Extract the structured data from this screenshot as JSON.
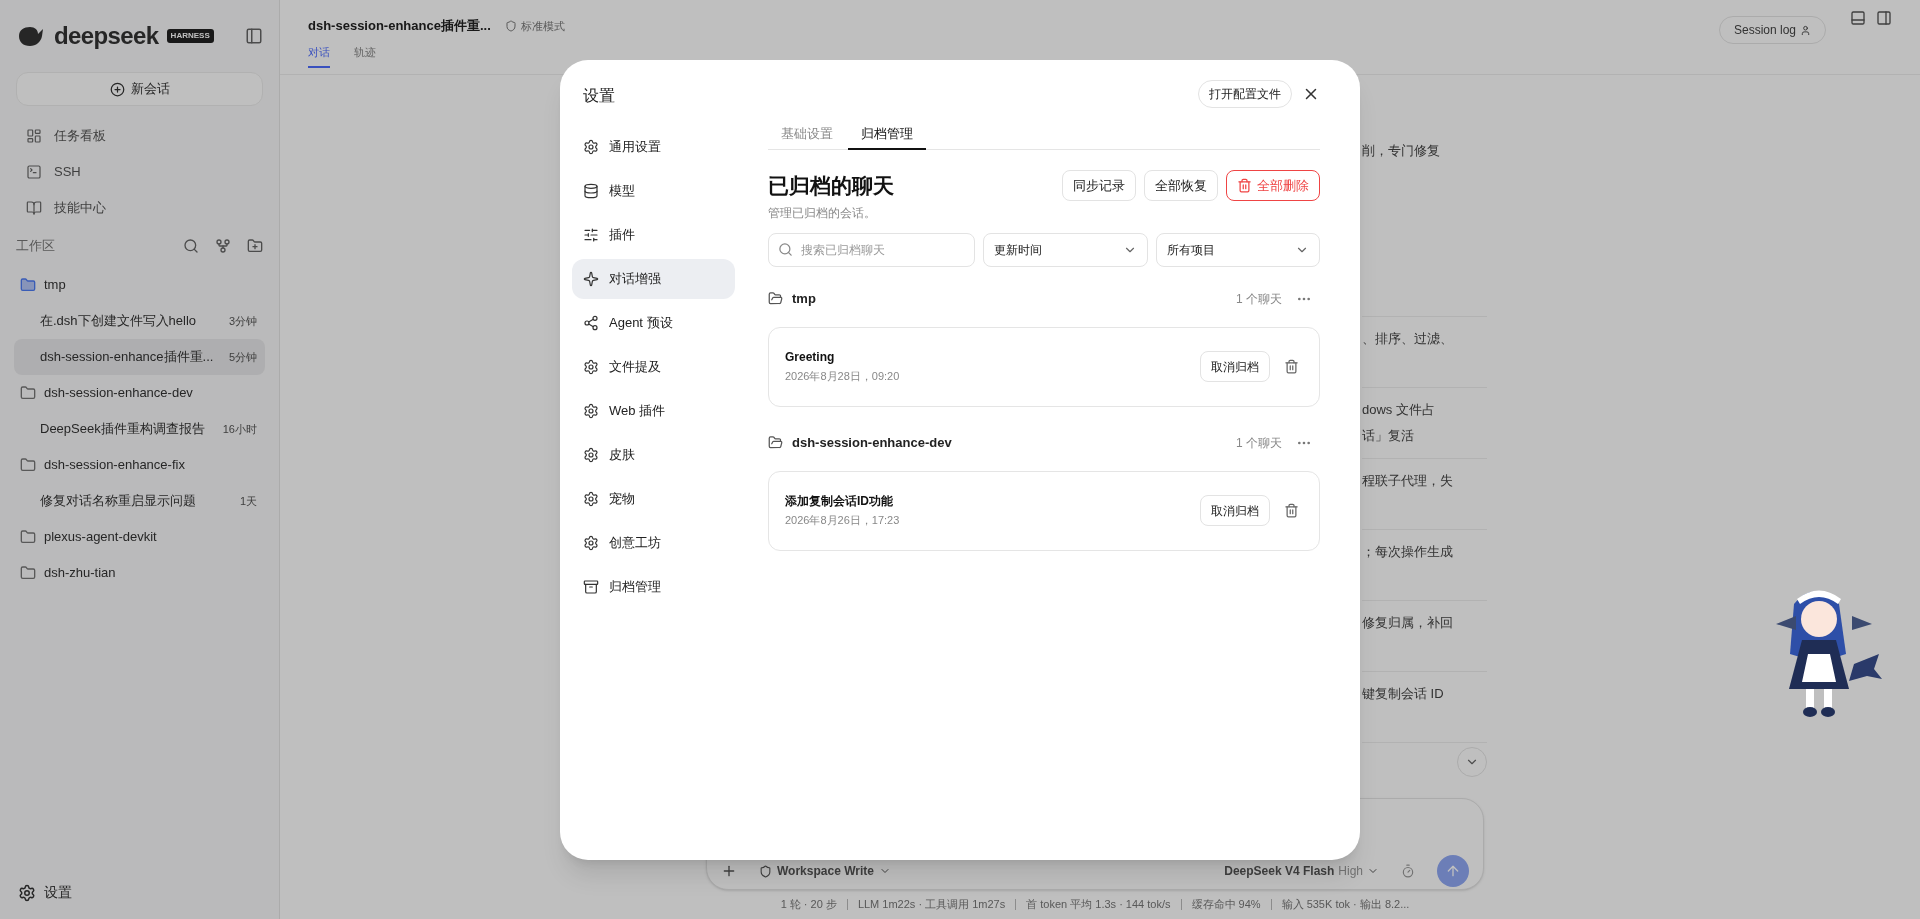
{
  "sidebar": {
    "logo": "deepseek",
    "badge": "HARNESS",
    "new_chat": "新会话",
    "nav": [
      {
        "label": "任务看板"
      },
      {
        "label": "SSH"
      },
      {
        "label": "技能中心"
      }
    ],
    "workspace_label": "工作区",
    "tree": [
      {
        "name": "tmp",
        "active": true,
        "children": [
          {
            "title": "在.dsh下创建文件写入hello",
            "time": "3分钟",
            "selected": false
          },
          {
            "title": "dsh-session-enhance插件重...",
            "time": "5分钟",
            "selected": true
          }
        ]
      },
      {
        "name": "dsh-session-enhance-dev",
        "active": false,
        "children": [
          {
            "title": "DeepSeek插件重构调查报告",
            "time": "16小时",
            "selected": false
          }
        ]
      },
      {
        "name": "dsh-session-enhance-fix",
        "active": false,
        "children": [
          {
            "title": "修复对话名称重启显示问题",
            "time": "1天",
            "selected": false
          }
        ]
      },
      {
        "name": "plexus-agent-devkit",
        "active": false
      },
      {
        "name": "dsh-zhu-tian",
        "active": false
      }
    ],
    "settings": "设置"
  },
  "header": {
    "title": "dsh-session-enhance插件重...",
    "mode": "标准模式",
    "tabs": [
      {
        "label": "对话",
        "selected": true
      },
      {
        "label": "轨迹",
        "selected": false
      }
    ],
    "session_log": "Session log"
  },
  "chat": {
    "fragments": [
      [
        "削，专门修复"
      ],
      [
        "、排序、过滤、"
      ],
      [
        "dows 文件占",
        "话」复活"
      ],
      [
        "程联子代理，失"
      ],
      [
        "；每次操作生成"
      ],
      [
        "修复归属，补回"
      ],
      [
        "键复制会话 ID"
      ]
    ]
  },
  "composer": {
    "permission": "Workspace Write",
    "model": "DeepSeek V4 Flash",
    "effort": "High"
  },
  "status_bar": [
    "1 轮 · 20 步",
    "LLM 1m22s · 工具调用 1m27s",
    "首 token 平均 1.3s · 144 tok/s",
    "缓存命中 94%",
    "输入 535K tok · 输出 8.2..."
  ],
  "dialog": {
    "title": "设置",
    "open_config": "打开配置文件",
    "nav": [
      {
        "label": "通用设置",
        "selected": false
      },
      {
        "label": "模型",
        "selected": false
      },
      {
        "label": "插件",
        "selected": false
      },
      {
        "label": "对话增强",
        "selected": true
      },
      {
        "label": "Agent 预设",
        "selected": false
      },
      {
        "label": "文件提及",
        "selected": false
      },
      {
        "label": "Web 插件",
        "selected": false
      },
      {
        "label": "皮肤",
        "selected": false
      },
      {
        "label": "宠物",
        "selected": false
      },
      {
        "label": "创意工坊",
        "selected": false
      },
      {
        "label": "归档管理",
        "selected": false
      }
    ],
    "tabs": [
      {
        "label": "基础设置",
        "selected": false
      },
      {
        "label": "归档管理",
        "selected": true
      }
    ],
    "heading": "已归档的聊天",
    "subtitle": "管理已归档的会话。",
    "actions": [
      {
        "label": "同步记录",
        "kind": "normal"
      },
      {
        "label": "全部恢复",
        "kind": "normal"
      },
      {
        "label": "全部删除",
        "kind": "danger"
      }
    ],
    "search": {
      "placeholder": "搜索已归档聊天"
    },
    "filters": [
      "更新时间",
      "所有项目"
    ],
    "groups": [
      {
        "name": "tmp",
        "count": "1 个聊天",
        "chats": [
          {
            "title": "Greeting",
            "date": "2026年8月28日，09:20",
            "action": "取消归档"
          }
        ]
      },
      {
        "name": "dsh-session-enhance-dev",
        "count": "1 个聊天",
        "chats": [
          {
            "title": "添加复制会话ID功能",
            "date": "2026年8月26日，17:23",
            "action": "取消归档"
          }
        ]
      }
    ]
  }
}
